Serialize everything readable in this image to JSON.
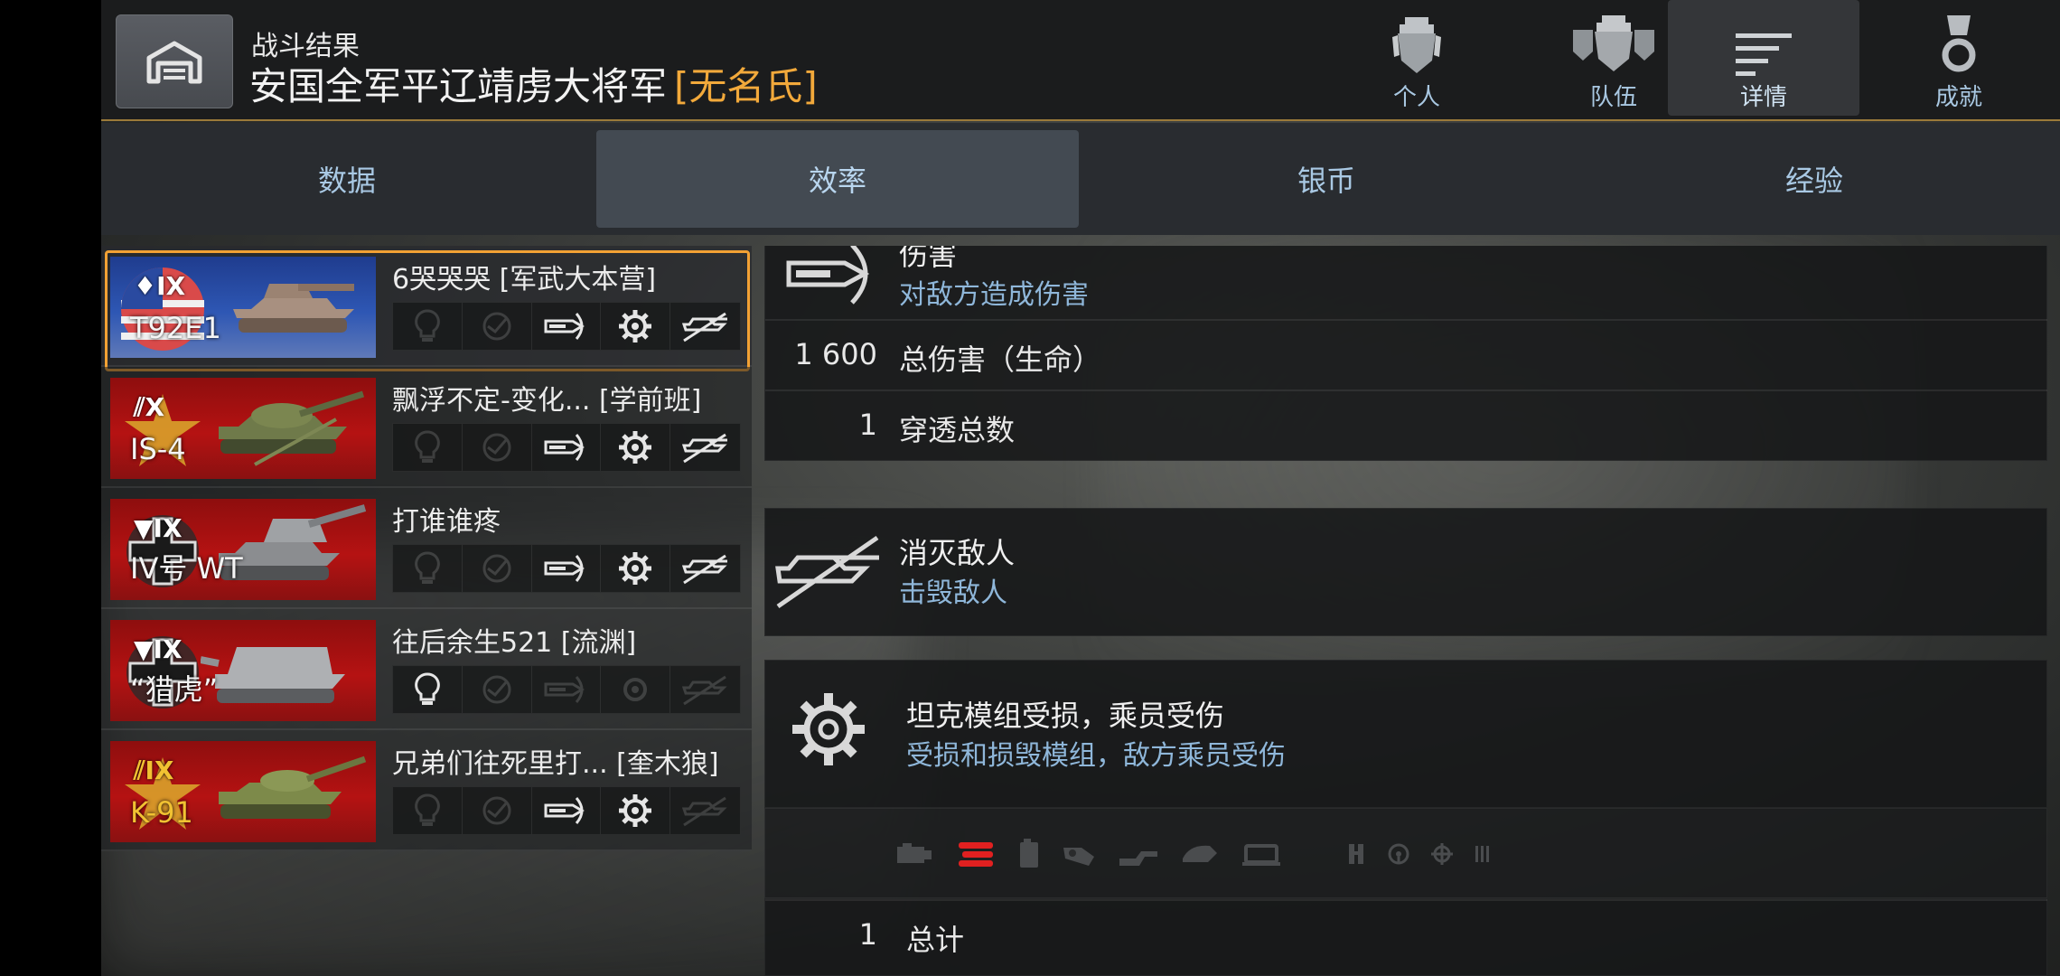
{
  "header": {
    "subtitle": "战斗结果",
    "title": "安国全军平辽靖虏大将军",
    "clan": "[无名氏]",
    "tabs": [
      {
        "label": "个人",
        "icon": "player-icon"
      },
      {
        "label": "队伍",
        "icon": "team-icon"
      },
      {
        "label": "详情",
        "icon": "details-icon"
      },
      {
        "label": "成就",
        "icon": "medal-icon"
      }
    ],
    "active_tab": "详情"
  },
  "subtabs": {
    "items": [
      "数据",
      "效率",
      "银币",
      "经验"
    ],
    "active": "效率"
  },
  "players": [
    {
      "tank": "T92E1",
      "tier": "IX",
      "nation": "usa",
      "name": "6哭哭哭 [军武大本营]",
      "badges": [
        false,
        false,
        true,
        true,
        true
      ],
      "selected": true
    },
    {
      "tank": "IS-4",
      "tier": "X",
      "nation": "ussr",
      "name": "飘浮不定-变化...   [学前班]",
      "badges": [
        false,
        false,
        true,
        true,
        true
      ],
      "selected": false
    },
    {
      "tank": "IV号 WT",
      "tier": "IX",
      "nation": "germany",
      "name": "打谁谁疼",
      "badges": [
        false,
        false,
        true,
        true,
        true
      ],
      "selected": false
    },
    {
      "tank": "“猎虎”",
      "tier": "IX",
      "nation": "germany",
      "name": "往后余生521 [流渊]",
      "badges": [
        true,
        false,
        false,
        false,
        false
      ],
      "selected": false
    },
    {
      "tank": "K-91",
      "tier": "IX",
      "nation": "ussr",
      "name": "兄弟们往死里打... [奎木狼]",
      "badges": [
        false,
        false,
        true,
        true,
        false
      ],
      "selected": false,
      "premium": true
    }
  ],
  "damage": {
    "title": "伤害",
    "subtitle": "对敌方造成伤害",
    "stats": [
      {
        "value": "1 600",
        "label": "总伤害（生命）"
      },
      {
        "value": "1",
        "label": "穿透总数"
      }
    ]
  },
  "kills": {
    "title": "消灭敌人",
    "subtitle": "击毁敌人"
  },
  "modules": {
    "title": "坦克模组受损，乘员受伤",
    "subtitle": "受损和损毁模组，敌方乘员受伤",
    "icons": [
      "engine-icon",
      "tracks-icon",
      "fuel-tank-icon",
      "ammo-rack-icon",
      "gun-icon",
      "turret-icon",
      "radio-icon",
      "commander-icon",
      "driver-icon",
      "gunner-icon",
      "loader-icon"
    ],
    "total": {
      "value": "1",
      "label": "总计"
    }
  },
  "colors": {
    "accent": "#f2a134",
    "link_blue": "#8fb7da",
    "track_damaged": "#e02020"
  }
}
